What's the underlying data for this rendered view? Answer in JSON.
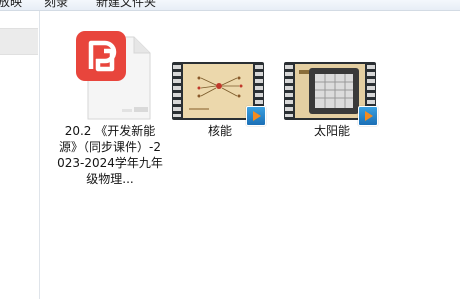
{
  "toolbar": {
    "items": [
      "放映",
      "刻录",
      "新建文件夹"
    ]
  },
  "files": [
    {
      "name": "20.2 《开发新能源》（同步课件）-2023-2024学年九年级物理...",
      "icon": "wps-pdf-icon"
    },
    {
      "name": "核能",
      "icon": "video-file-icon"
    },
    {
      "name": "太阳能",
      "icon": "video-file-icon"
    }
  ],
  "colors": {
    "pdf_red": "#e8453c",
    "video_frame": "#e8d3a6",
    "play_badge": "#1b6fb6"
  }
}
